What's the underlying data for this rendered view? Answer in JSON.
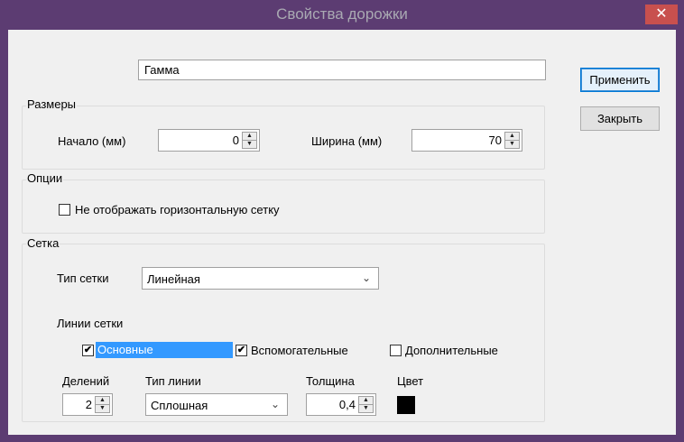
{
  "window": {
    "title": "Свойства дорожки",
    "close_label": "✕"
  },
  "name_field": {
    "value": "Гамма"
  },
  "buttons": {
    "apply": "Применить",
    "close": "Закрыть"
  },
  "sizes": {
    "group_label": "Размеры",
    "start_label": "Начало (мм)",
    "start_value": "0",
    "width_label": "Ширина (мм)",
    "width_value": "70"
  },
  "options": {
    "group_label": "Опции",
    "hide_grid_label": "Не отображать горизонтальную сетку",
    "hide_grid_checked": false
  },
  "grid": {
    "group_label": "Сетка",
    "type_label": "Тип сетки",
    "type_value": "Линейная",
    "lines_label": "Линии сетки",
    "main_label": "Основные",
    "main_checked": true,
    "aux_label": "Вспомогательные",
    "aux_checked": true,
    "extra_label": "Дополнительные",
    "extra_checked": false,
    "divisions_label": "Делений",
    "divisions_value": "2",
    "line_type_label": "Тип линии",
    "line_type_value": "Сплошная",
    "thickness_label": "Толщина",
    "thickness_value": "0,4",
    "color_label": "Цвет",
    "color_value": "#000000"
  },
  "icons": {
    "check": "✔",
    "spin_up": "▲",
    "spin_down": "▼",
    "dropdown": "⌄"
  }
}
